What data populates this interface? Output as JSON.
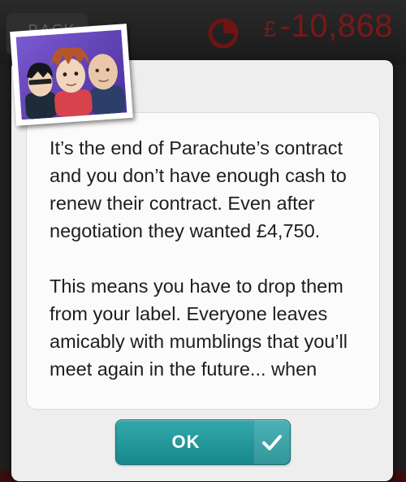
{
  "header": {
    "back_label": "BACK",
    "currency_symbol": "£",
    "cash_value": "-10,868",
    "icons": [
      "back-arrow",
      "pie-chart-icon"
    ]
  },
  "dialog": {
    "image": "band-photo",
    "paragraphs": [
      "It’s the end of Parachute’s contract and you don’t have enough cash to renew their contract. Even after negotiation they wanted £4,750.",
      "This means you have to drop them from your label. Everyone leaves amicably with mumblings that you’ll meet again in the future... when"
    ],
    "ok_label": "OK",
    "ok_icon": "check-icon"
  },
  "colors": {
    "accent": "#1f969a",
    "cash_negative": "#7a1818",
    "dialog_bg": "#eeeeee",
    "card_bg": "#fbfbfb",
    "text": "#1e1e1e"
  }
}
